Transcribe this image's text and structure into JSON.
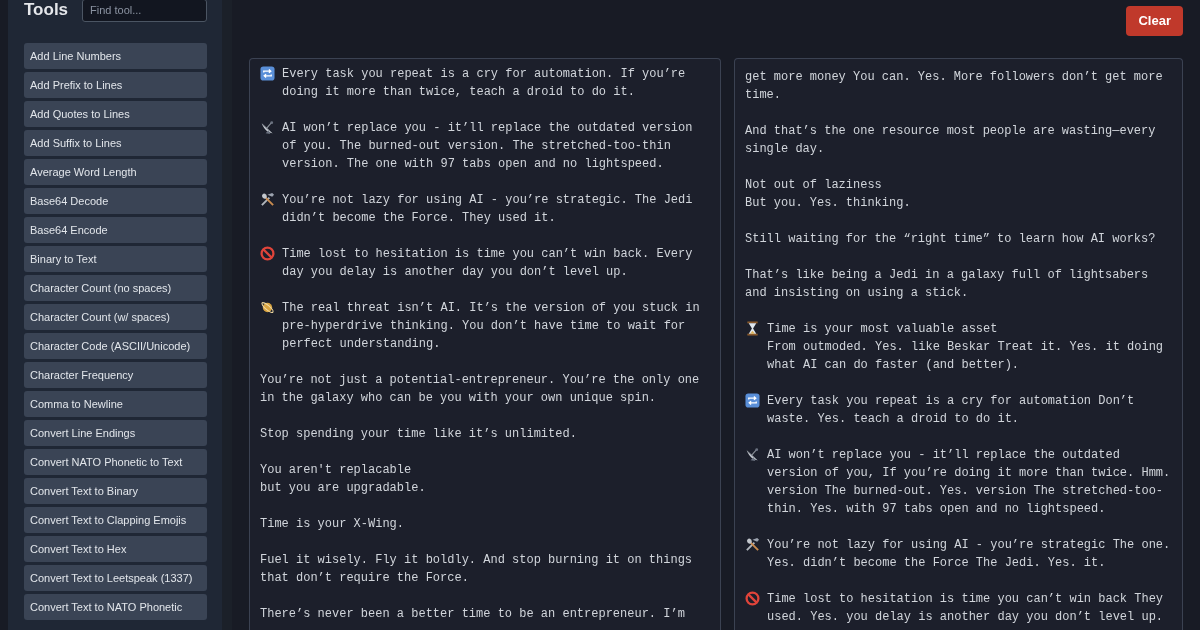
{
  "sidebar": {
    "title": "Tools",
    "search": {
      "placeholder": "Find tool..."
    },
    "items": [
      {
        "label": "Add Line Numbers"
      },
      {
        "label": "Add Prefix to Lines"
      },
      {
        "label": "Add Quotes to Lines"
      },
      {
        "label": "Add Suffix to Lines"
      },
      {
        "label": "Average Word Length"
      },
      {
        "label": "Base64 Decode"
      },
      {
        "label": "Base64 Encode"
      },
      {
        "label": "Binary to Text"
      },
      {
        "label": "Character Count (no spaces)"
      },
      {
        "label": "Character Count (w/ spaces)"
      },
      {
        "label": "Character Code (ASCII/Unicode)"
      },
      {
        "label": "Character Frequency"
      },
      {
        "label": "Comma to Newline"
      },
      {
        "label": "Convert Line Endings"
      },
      {
        "label": "Convert NATO Phonetic to Text"
      },
      {
        "label": "Convert Text to Binary"
      },
      {
        "label": "Convert Text to Clapping Emojis"
      },
      {
        "label": "Convert Text to Hex"
      },
      {
        "label": "Convert Text to Leetspeak (1337)"
      },
      {
        "label": "Convert Text to NATO Phonetic"
      }
    ]
  },
  "toolbar": {
    "clear_button": "Clear"
  },
  "input_panel": {
    "paragraphs": [
      {
        "kind": "repeat",
        "text": "Every task you repeat is a cry for automation. If you’re doing it more than twice, teach a droid to do it."
      },
      {
        "kind": "dish",
        "text": "AI won’t replace you - it’ll replace the outdated version of you. The burned-out version. The stretched-too-thin version. The one with 97 tabs open and no lightspeed."
      },
      {
        "kind": "tools",
        "text": "You’re not lazy for using AI - you’re strategic. The Jedi didn’t become the Force. They used it."
      },
      {
        "kind": "prohibited",
        "text": "Time lost to hesitation is time you can’t win back. Every day you delay is another day you don’t level up."
      },
      {
        "kind": "planet",
        "text": "The real threat isn’t AI. It’s the version of you stuck in pre-hyperdrive thinking. You don’t have time to wait for perfect understanding."
      },
      {
        "kind": "plain",
        "text": "You’re not just a potential-entrepreneur. You’re the only one in the galaxy who can be you with your own unique spin."
      },
      {
        "kind": "plain",
        "text": "Stop spending your time like it’s unlimited."
      },
      {
        "kind": "plain",
        "text": "You aren't replacable\nbut you are upgradable."
      },
      {
        "kind": "plain",
        "text": "Time is your X-Wing."
      },
      {
        "kind": "plain",
        "text": "Fuel it wisely. Fly it boldly. And stop burning it on things that don’t require the Force."
      },
      {
        "kind": "plain",
        "text": "There’s never been a better time to be an entrepreneur. I’m"
      }
    ]
  },
  "output_panel": {
    "paragraphs": [
      {
        "kind": "plain",
        "text": "get more money You can. Yes. More followers don’t get more time."
      },
      {
        "kind": "plain",
        "text": "And that’s the one resource most people are wasting—every single day."
      },
      {
        "kind": "plain",
        "text": "Not out of laziness\nBut you. Yes. thinking."
      },
      {
        "kind": "plain",
        "text": "Still waiting for the “right time” to learn how AI works?"
      },
      {
        "kind": "plain",
        "text": "That’s like being a Jedi in a galaxy full of lightsabers and insisting on using a stick."
      },
      {
        "kind": "hourglass",
        "text": "Time is your most valuable asset\nFrom outmoded. Yes. like Beskar Treat it. Yes. it doing what AI can do faster (and better)."
      },
      {
        "kind": "repeat",
        "text": "Every task you repeat is a cry for automation Don’t waste. Yes. teach a droid to do it."
      },
      {
        "kind": "dish",
        "text": "AI won’t replace you - it’ll replace the outdated version of you, If you’re doing it more than twice. Hmm. version The burned-out. Yes. version The stretched-too-thin. Yes. with 97 tabs open and no lightspeed."
      },
      {
        "kind": "tools",
        "text": "You’re not lazy for using AI - you’re strategic The one. Yes. didn’t become the Force The Jedi. Yes. it."
      },
      {
        "kind": "prohibited",
        "text": "Time lost to hesitation is time you can’t win back They used. Yes. you delay is another day you don’t level up."
      }
    ]
  }
}
